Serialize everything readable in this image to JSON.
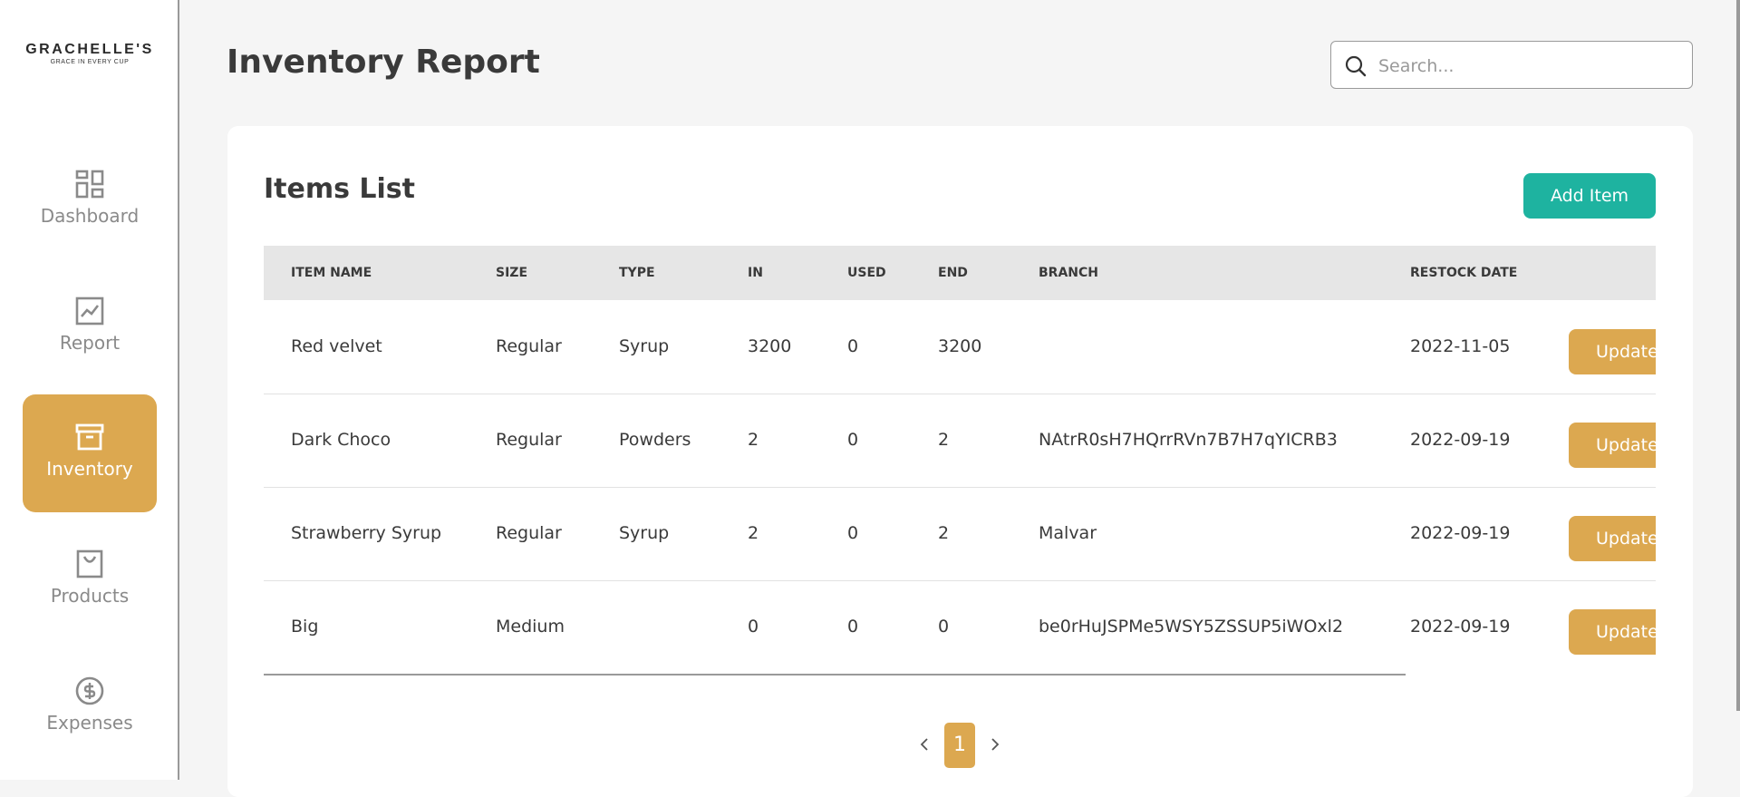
{
  "brand": {
    "name": "GRACHELLE'S",
    "tagline": "GRACE IN EVERY CUP"
  },
  "sidebar": {
    "items": [
      {
        "label": "Dashboard",
        "icon": "dashboard-icon",
        "active": false
      },
      {
        "label": "Report",
        "icon": "chart-icon",
        "active": false
      },
      {
        "label": "Inventory",
        "icon": "archive-box-icon",
        "active": true
      },
      {
        "label": "Products",
        "icon": "shopping-bag-icon",
        "active": false
      },
      {
        "label": "Expenses",
        "icon": "dollar-circle-icon",
        "active": false
      }
    ]
  },
  "header": {
    "title": "Inventory Report",
    "search_placeholder": "Search...",
    "search_value": ""
  },
  "card": {
    "title": "Items List",
    "add_button": "Add Item"
  },
  "table": {
    "columns": [
      "ITEM NAME",
      "SIZE",
      "TYPE",
      "IN",
      "USED",
      "END",
      "BRANCH",
      "RESTOCK DATE"
    ],
    "rows": [
      [
        "Red velvet",
        "Regular",
        "Syrup",
        "3200",
        "0",
        "3200",
        "",
        "2022-11-05"
      ],
      [
        "Dark Choco",
        "Regular",
        "Powders",
        "2",
        "0",
        "2",
        "NAtrR0sH7HQrrRVn7B7H7qYICRB3",
        "2022-09-19"
      ],
      [
        "Strawberry Syrup",
        "Regular",
        "Syrup",
        "2",
        "0",
        "2",
        "Malvar",
        "2022-09-19"
      ],
      [
        "Big",
        "Medium",
        "",
        "0",
        "0",
        "0",
        "be0rHuJSPMe5WSY5ZSSUP5iWOxl2",
        "2022-09-19"
      ]
    ],
    "update_label": "Update"
  },
  "pagination": {
    "current": "1"
  },
  "colors": {
    "accent": "#dca850",
    "primary_button": "#1eb3a0",
    "background": "#f5f5f5"
  }
}
